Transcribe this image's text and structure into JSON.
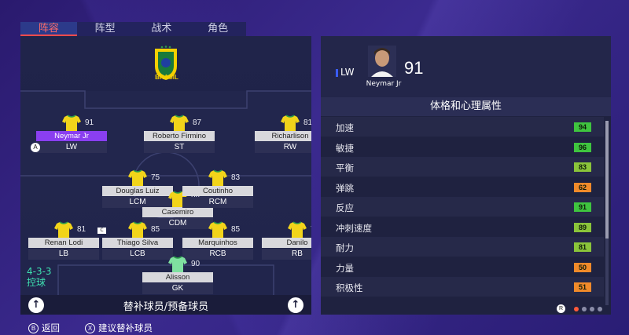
{
  "tabs": [
    "阵容",
    "阵型",
    "战术",
    "角色"
  ],
  "active_tab": 0,
  "team": {
    "name": "BRASIL",
    "crest_icon": "cbf-crest-icon"
  },
  "colors": {
    "accent": "#ff4b4b",
    "selected": "#8a3ff0",
    "kit_yellow": "#f2d41a",
    "kit_green": "#2a9a4a",
    "gk_kit": "#7fe0a0"
  },
  "players": [
    {
      "name": "Neymar Jr",
      "pos": "LW",
      "rating": "91",
      "selected": true,
      "badge": "A"
    },
    {
      "name": "Roberto Firmino",
      "pos": "ST",
      "rating": "87"
    },
    {
      "name": "Richarlison",
      "pos": "RW",
      "rating": "81"
    },
    {
      "name": "Douglas Luiz",
      "pos": "LCM",
      "rating": "75"
    },
    {
      "name": "Casemiro",
      "pos": "CDM",
      "rating": "89"
    },
    {
      "name": "Coutinho",
      "pos": "RCM",
      "rating": "83"
    },
    {
      "name": "Renan Lodi",
      "pos": "LB",
      "rating": "81"
    },
    {
      "name": "Thiago Silva",
      "pos": "LCB",
      "rating": "85",
      "captain": "C"
    },
    {
      "name": "Marquinhos",
      "pos": "RCB",
      "rating": "85"
    },
    {
      "name": "Danilo",
      "pos": "RB",
      "rating": "79"
    },
    {
      "name": "Alisson",
      "pos": "GK",
      "rating": "90",
      "gk": true
    }
  ],
  "formation": "4-3-3",
  "mentality": "控球",
  "bottom_bar": {
    "label": "替补球员/预备球员",
    "left_btn": "↑",
    "right_btn": "↑"
  },
  "detail": {
    "pos": "LW",
    "name": "Neymar Jr",
    "rating": "91",
    "section_title": "体格和心理属性",
    "attributes": [
      {
        "name": "加速",
        "value": "94",
        "color": "#3fc43f"
      },
      {
        "name": "敏捷",
        "value": "96",
        "color": "#3fc43f"
      },
      {
        "name": "平衡",
        "value": "83",
        "color": "#8ac43a"
      },
      {
        "name": "弹跳",
        "value": "62",
        "color": "#f08a2a"
      },
      {
        "name": "反应",
        "value": "91",
        "color": "#3fc43f"
      },
      {
        "name": "冲刺速度",
        "value": "89",
        "color": "#8ac43a"
      },
      {
        "name": "耐力",
        "value": "81",
        "color": "#8ac43a"
      },
      {
        "name": "力量",
        "value": "50",
        "color": "#f08a2a"
      },
      {
        "name": "积极性",
        "value": "51",
        "color": "#f08a2a"
      }
    ],
    "pager_label": "R"
  },
  "footer": [
    {
      "glyph": "B",
      "label": "返回"
    },
    {
      "glyph": "X",
      "label": "建议替补球员"
    }
  ]
}
